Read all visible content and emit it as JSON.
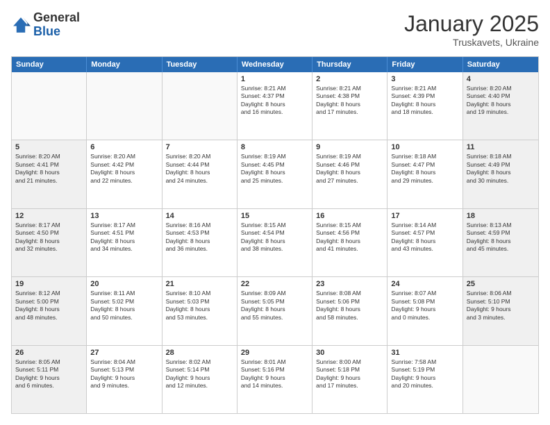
{
  "logo": {
    "general": "General",
    "blue": "Blue"
  },
  "header": {
    "month_year": "January 2025",
    "location": "Truskavets, Ukraine"
  },
  "weekdays": [
    "Sunday",
    "Monday",
    "Tuesday",
    "Wednesday",
    "Thursday",
    "Friday",
    "Saturday"
  ],
  "rows": [
    [
      {
        "day": "",
        "text": "",
        "empty": true
      },
      {
        "day": "",
        "text": "",
        "empty": true
      },
      {
        "day": "",
        "text": "",
        "empty": true
      },
      {
        "day": "1",
        "text": "Sunrise: 8:21 AM\nSunset: 4:37 PM\nDaylight: 8 hours\nand 16 minutes.",
        "shaded": false
      },
      {
        "day": "2",
        "text": "Sunrise: 8:21 AM\nSunset: 4:38 PM\nDaylight: 8 hours\nand 17 minutes.",
        "shaded": false
      },
      {
        "day": "3",
        "text": "Sunrise: 8:21 AM\nSunset: 4:39 PM\nDaylight: 8 hours\nand 18 minutes.",
        "shaded": false
      },
      {
        "day": "4",
        "text": "Sunrise: 8:20 AM\nSunset: 4:40 PM\nDaylight: 8 hours\nand 19 minutes.",
        "shaded": true
      }
    ],
    [
      {
        "day": "5",
        "text": "Sunrise: 8:20 AM\nSunset: 4:41 PM\nDaylight: 8 hours\nand 21 minutes.",
        "shaded": true
      },
      {
        "day": "6",
        "text": "Sunrise: 8:20 AM\nSunset: 4:42 PM\nDaylight: 8 hours\nand 22 minutes.",
        "shaded": false
      },
      {
        "day": "7",
        "text": "Sunrise: 8:20 AM\nSunset: 4:44 PM\nDaylight: 8 hours\nand 24 minutes.",
        "shaded": false
      },
      {
        "day": "8",
        "text": "Sunrise: 8:19 AM\nSunset: 4:45 PM\nDaylight: 8 hours\nand 25 minutes.",
        "shaded": false
      },
      {
        "day": "9",
        "text": "Sunrise: 8:19 AM\nSunset: 4:46 PM\nDaylight: 8 hours\nand 27 minutes.",
        "shaded": false
      },
      {
        "day": "10",
        "text": "Sunrise: 8:18 AM\nSunset: 4:47 PM\nDaylight: 8 hours\nand 29 minutes.",
        "shaded": false
      },
      {
        "day": "11",
        "text": "Sunrise: 8:18 AM\nSunset: 4:49 PM\nDaylight: 8 hours\nand 30 minutes.",
        "shaded": true
      }
    ],
    [
      {
        "day": "12",
        "text": "Sunrise: 8:17 AM\nSunset: 4:50 PM\nDaylight: 8 hours\nand 32 minutes.",
        "shaded": true
      },
      {
        "day": "13",
        "text": "Sunrise: 8:17 AM\nSunset: 4:51 PM\nDaylight: 8 hours\nand 34 minutes.",
        "shaded": false
      },
      {
        "day": "14",
        "text": "Sunrise: 8:16 AM\nSunset: 4:53 PM\nDaylight: 8 hours\nand 36 minutes.",
        "shaded": false
      },
      {
        "day": "15",
        "text": "Sunrise: 8:15 AM\nSunset: 4:54 PM\nDaylight: 8 hours\nand 38 minutes.",
        "shaded": false
      },
      {
        "day": "16",
        "text": "Sunrise: 8:15 AM\nSunset: 4:56 PM\nDaylight: 8 hours\nand 41 minutes.",
        "shaded": false
      },
      {
        "day": "17",
        "text": "Sunrise: 8:14 AM\nSunset: 4:57 PM\nDaylight: 8 hours\nand 43 minutes.",
        "shaded": false
      },
      {
        "day": "18",
        "text": "Sunrise: 8:13 AM\nSunset: 4:59 PM\nDaylight: 8 hours\nand 45 minutes.",
        "shaded": true
      }
    ],
    [
      {
        "day": "19",
        "text": "Sunrise: 8:12 AM\nSunset: 5:00 PM\nDaylight: 8 hours\nand 48 minutes.",
        "shaded": true
      },
      {
        "day": "20",
        "text": "Sunrise: 8:11 AM\nSunset: 5:02 PM\nDaylight: 8 hours\nand 50 minutes.",
        "shaded": false
      },
      {
        "day": "21",
        "text": "Sunrise: 8:10 AM\nSunset: 5:03 PM\nDaylight: 8 hours\nand 53 minutes.",
        "shaded": false
      },
      {
        "day": "22",
        "text": "Sunrise: 8:09 AM\nSunset: 5:05 PM\nDaylight: 8 hours\nand 55 minutes.",
        "shaded": false
      },
      {
        "day": "23",
        "text": "Sunrise: 8:08 AM\nSunset: 5:06 PM\nDaylight: 8 hours\nand 58 minutes.",
        "shaded": false
      },
      {
        "day": "24",
        "text": "Sunrise: 8:07 AM\nSunset: 5:08 PM\nDaylight: 9 hours\nand 0 minutes.",
        "shaded": false
      },
      {
        "day": "25",
        "text": "Sunrise: 8:06 AM\nSunset: 5:10 PM\nDaylight: 9 hours\nand 3 minutes.",
        "shaded": true
      }
    ],
    [
      {
        "day": "26",
        "text": "Sunrise: 8:05 AM\nSunset: 5:11 PM\nDaylight: 9 hours\nand 6 minutes.",
        "shaded": true
      },
      {
        "day": "27",
        "text": "Sunrise: 8:04 AM\nSunset: 5:13 PM\nDaylight: 9 hours\nand 9 minutes.",
        "shaded": false
      },
      {
        "day": "28",
        "text": "Sunrise: 8:02 AM\nSunset: 5:14 PM\nDaylight: 9 hours\nand 12 minutes.",
        "shaded": false
      },
      {
        "day": "29",
        "text": "Sunrise: 8:01 AM\nSunset: 5:16 PM\nDaylight: 9 hours\nand 14 minutes.",
        "shaded": false
      },
      {
        "day": "30",
        "text": "Sunrise: 8:00 AM\nSunset: 5:18 PM\nDaylight: 9 hours\nand 17 minutes.",
        "shaded": false
      },
      {
        "day": "31",
        "text": "Sunrise: 7:58 AM\nSunset: 5:19 PM\nDaylight: 9 hours\nand 20 minutes.",
        "shaded": false
      },
      {
        "day": "",
        "text": "",
        "empty": true
      }
    ]
  ]
}
